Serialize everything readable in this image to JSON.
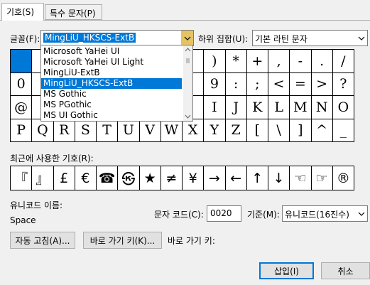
{
  "tabs": [
    {
      "label": "기호(S)"
    },
    {
      "label": "특수 문자(P)"
    }
  ],
  "font": {
    "label": "글꼴(F):",
    "value": "MingLiU_HKSCS-ExtB"
  },
  "subset": {
    "label": "하위 집합(U):",
    "value": "기본 라틴 문자"
  },
  "font_list": [
    "Microsoft YaHei UI",
    "Microsoft YaHei UI Light",
    "MingLiU-ExtB",
    "MingLiU_HKSCS-ExtB",
    "MS Gothic",
    "MS PGothic",
    "MS UI Gothic"
  ],
  "font_list_selected": 3,
  "grid": [
    [
      "",
      "",
      "",
      "",
      "",
      "",
      "",
      "",
      "",
      "",
      ")",
      "*",
      "+",
      ",",
      "-",
      ".",
      "/"
    ],
    [
      "0",
      "",
      "",
      "",
      "",
      "",
      "",
      "",
      "",
      "9",
      ":",
      ";",
      "<",
      "=",
      ">",
      "?"
    ],
    [
      "@",
      "",
      "",
      "",
      "",
      "",
      "",
      "",
      "",
      "I",
      "J",
      "K",
      "L",
      "M",
      "N",
      "O"
    ],
    [
      "P",
      "Q",
      "R",
      "S",
      "T",
      "U",
      "V",
      "W",
      "X",
      "Y",
      "Z",
      "[",
      "\\",
      "]",
      "^",
      "_"
    ]
  ],
  "recent_label": "최근에 사용한 기호(R):",
  "recent": [
    "『",
    "』",
    "£",
    "€",
    "☎",
    "㉿",
    "★",
    "≠",
    "¥",
    "→",
    "←",
    "↑",
    "↓",
    "☜",
    "☞",
    "®"
  ],
  "unicode_name_label": "유니코드 이름:",
  "unicode_name": "Space",
  "char_code_label": "문자 코드(C):",
  "char_code": "0020",
  "basis_label": "기준(M):",
  "basis_value": "유니코드(16진수)",
  "autocorrect_btn": "자동 고침(A)...",
  "shortcut_btn": "바로 가기 키(K)...",
  "shortcut_label": "바로 가기 키:",
  "insert_btn": "삽입(I)",
  "cancel_btn": "취소",
  "colors": {
    "accent": "#0078d7"
  }
}
